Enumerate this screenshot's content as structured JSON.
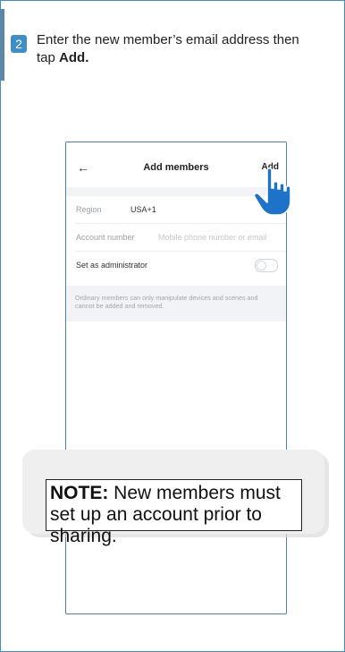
{
  "step": {
    "number": "2",
    "text_prefix": "Enter the new member’s email address then tap ",
    "text_bold": "Add."
  },
  "phone": {
    "back_icon": "←",
    "title": "Add members",
    "add_label": "Add",
    "region_label": "Region",
    "region_value": "USA+1",
    "account_label": "Account number",
    "account_placeholder": "Mobile phone number or email",
    "admin_label": "Set as administrator",
    "admin_enabled": false,
    "info_text": "Ordinary members can only manipulate devices and scenes and cannot be added and removed."
  },
  "note": {
    "label": "NOTE:",
    "text": " New members must set up an account prior to sharing."
  },
  "colors": {
    "frame": "#3f8fc6",
    "badge": "#3f8fc6",
    "hand": "#1e73c8"
  },
  "icons": [
    "back-arrow-icon",
    "pointing-hand-icon"
  ]
}
